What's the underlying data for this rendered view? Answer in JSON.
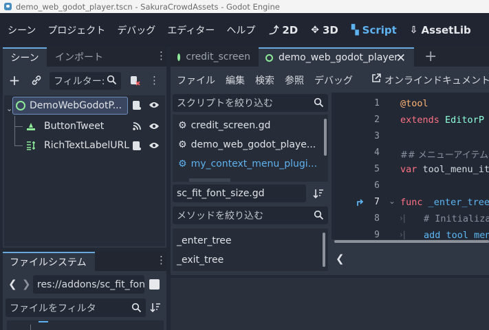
{
  "window": {
    "title": "demo_web_godot_player.tscn - SakuraCrowdAssets - Godot Engine"
  },
  "menu": {
    "items": [
      "シーン",
      "プロジェクト",
      "デバッグ",
      "エディター",
      "ヘルプ"
    ]
  },
  "workspaces": [
    {
      "label": "2D",
      "icon": "⤴"
    },
    {
      "label": "3D",
      "icon": "✥"
    },
    {
      "label": "Script",
      "icon": "▚"
    },
    {
      "label": "AssetLib",
      "icon": "⇩"
    }
  ],
  "scene_dock": {
    "tabs": [
      "シーン",
      "インポート"
    ],
    "filter_placeholder": "フィルター:",
    "nodes": [
      {
        "name": "DemoWebGodotP..."
      },
      {
        "name": "ButtonTweet"
      },
      {
        "name": "RichTextLabelURL"
      }
    ]
  },
  "filesystem_dock": {
    "tab": "ファイルシステム",
    "path": "res://addons/sc_fit_fon",
    "filter_placeholder": "ファイルをフィルタ"
  },
  "editor_tabs": [
    "credit_screen",
    "demo_web_godot_player"
  ],
  "script_menu": [
    "ファイル",
    "編集",
    "検索",
    "参照",
    "デバッグ"
  ],
  "online_docs": "オンラインドキュメント",
  "script_filter_placeholder": "スクリプトを絞り込む",
  "scripts": [
    "credit_screen.gd",
    "demo_web_godot_playe...",
    "my_context_menu_plugi..."
  ],
  "current_script": "sc_fit_font_size.gd",
  "method_filter_placeholder": "メソッドを絞り込む",
  "methods": [
    "_enter_tree",
    "_exit_tree"
  ],
  "code": {
    "line_numbers": [
      "1",
      "2",
      "3",
      "4",
      "5",
      "6",
      "7",
      "8",
      "9"
    ],
    "l1": "@tool",
    "l2_kw": "extends",
    "l2_ty": "EditorP",
    "l4": "## メニューアイテム",
    "l5_kw": "var",
    "l5_tx": "tool_menu_it",
    "l7_kw": "func",
    "l7_fn": "_enter_tree",
    "l8": "# Initializa",
    "l9": "add_tool_men"
  },
  "colors": {
    "accent": "#5fb2f0",
    "keyword": "#ff7185",
    "type": "#8effda",
    "comment": "#8a93a0"
  }
}
